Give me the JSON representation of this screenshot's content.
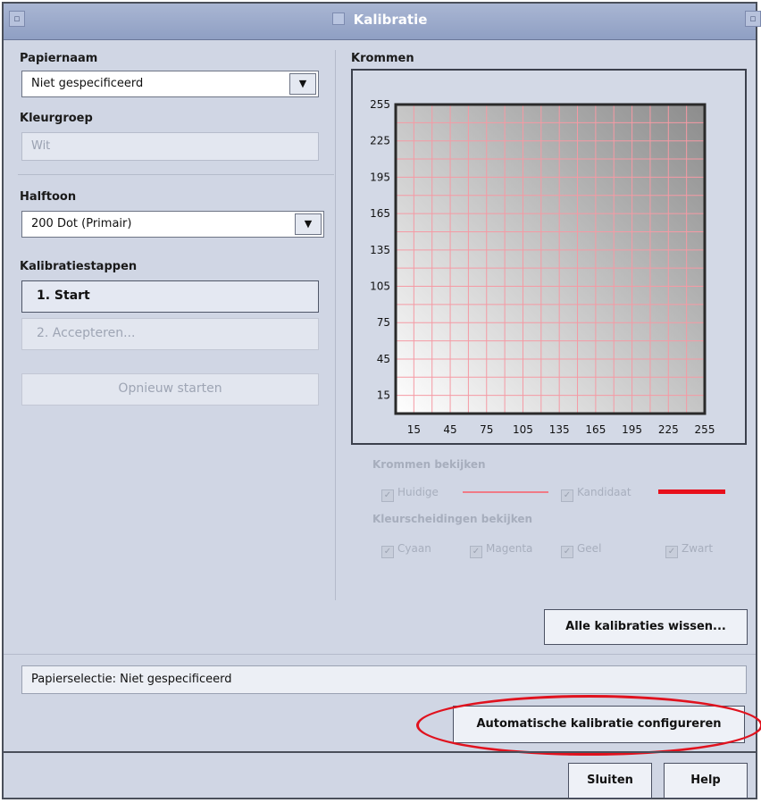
{
  "window": {
    "title": "Kalibratie"
  },
  "left": {
    "paper_name_label": "Papiernaam",
    "paper_name_value": "Niet gespecificeerd",
    "color_group_label": "Kleurgroep",
    "color_group_value": "Wit",
    "halftone_label": "Halftoon",
    "halftone_value": "200 Dot (Primair)",
    "steps_label": "Kalibratiestappen",
    "step1": "1. Start",
    "step2": "2. Accepteren...",
    "restart": "Opnieuw starten"
  },
  "curves": {
    "label": "Krommen",
    "view_label": "Krommen bekijken",
    "current_label": "Huidige",
    "candidate_label": "Kandidaat",
    "current_color": "#f07a86",
    "candidate_color": "#e8101c",
    "separations_label": "Kleurscheidingen bekijken",
    "separations": [
      "Cyaan",
      "Magenta",
      "Geel",
      "Zwart"
    ]
  },
  "chart_data": {
    "type": "line",
    "title": "",
    "xlabel": "",
    "ylabel": "",
    "xlim": [
      0,
      255
    ],
    "ylim": [
      0,
      255
    ],
    "x_ticks": [
      15,
      45,
      75,
      105,
      135,
      165,
      195,
      225,
      255
    ],
    "y_ticks": [
      255,
      225,
      195,
      165,
      135,
      105,
      75,
      45,
      15
    ],
    "grid": true,
    "grid_color": "#f59aa4"
  },
  "buttons": {
    "clear_all": "Alle kalibraties wissen...",
    "auto_config": "Automatische kalibratie configureren",
    "close": "Sluiten",
    "help": "Help"
  },
  "status": {
    "text": "Papierselectie: Niet gespecificeerd"
  },
  "annotation": {
    "color": "#e0121e"
  },
  "icons": {
    "dropdown": "chevron-down-icon",
    "check": "check-icon"
  }
}
